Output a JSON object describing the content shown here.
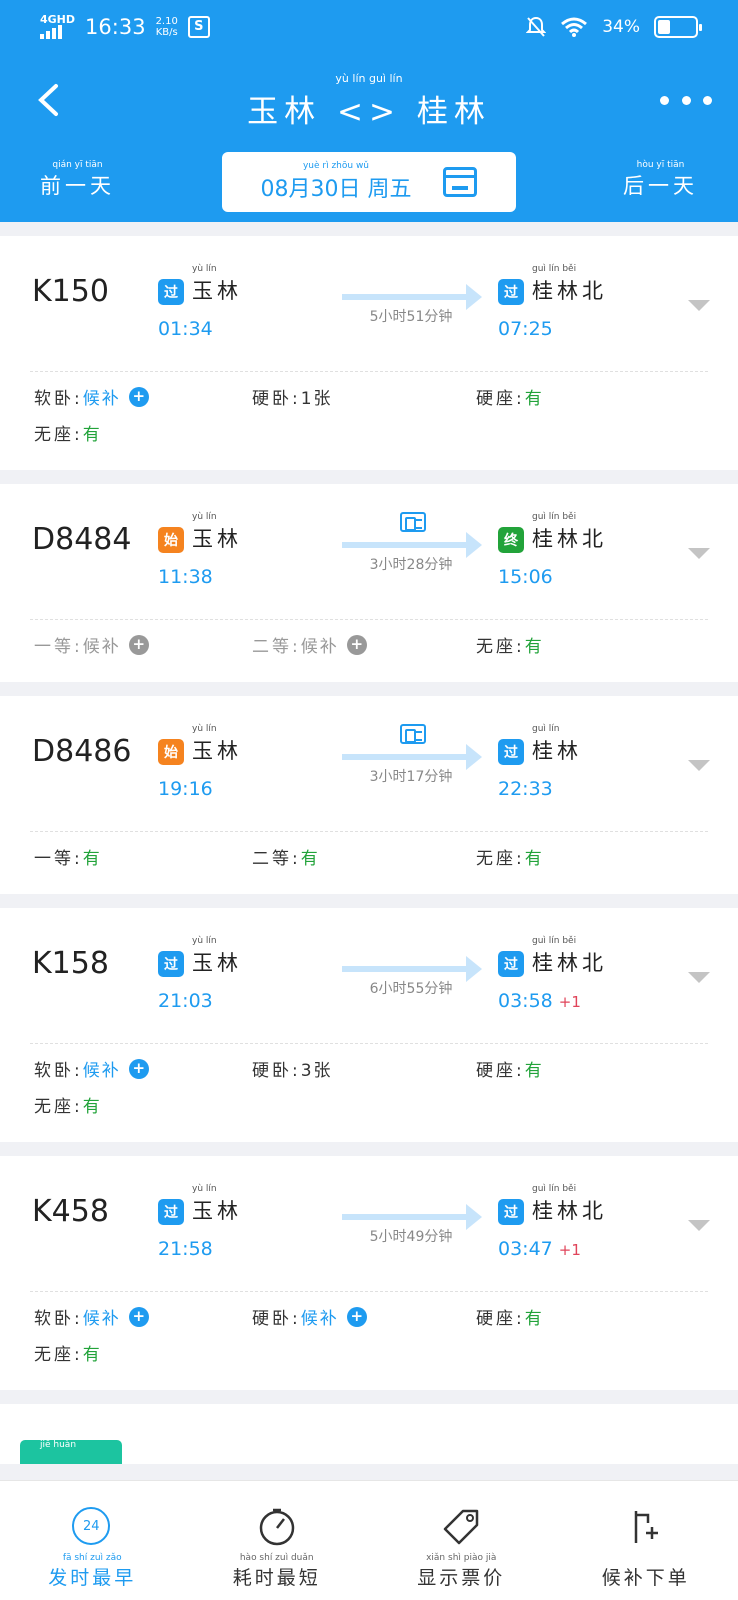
{
  "status_bar": {
    "network": "4GHD",
    "time": "16:33",
    "speed_value": "2.10",
    "speed_unit": "KB/s",
    "battery_pct": "34%",
    "battery_level": 0.34
  },
  "header": {
    "title_py": "yù   lín          guì   lín",
    "title": "玉林 <> 桂林",
    "prev_day_py": "qián yī tiān",
    "prev_day": "前一天",
    "next_day_py": "hòu yī tiān",
    "next_day": "后一天",
    "date_py": "yuè  rì  zhōu wǔ",
    "date": "08月30日 周五"
  },
  "trains": [
    {
      "number": "K150",
      "from_badge": "过",
      "from_py": "yù lín",
      "from": "玉林",
      "depart": "01:34",
      "duration": "5小时51分钟",
      "has_id_icon": false,
      "to_badge": "过",
      "to_py": "guì lín běi",
      "to": "桂林北",
      "arrive": "07:25",
      "next_day": "",
      "seats": [
        [
          {
            "name": "软卧:",
            "value": "候补",
            "plus": "+"
          },
          {
            "name": "硬卧:",
            "value": "1张"
          },
          {
            "name": "硬座:",
            "value": "有"
          }
        ],
        [
          {
            "name": "无座:",
            "value": "有"
          }
        ]
      ]
    },
    {
      "number": "D8484",
      "from_badge": "始",
      "from_py": "yù lín",
      "from": "玉林",
      "depart": "11:38",
      "duration": "3小时28分钟",
      "has_id_icon": true,
      "to_badge": "终",
      "to_py": "guì lín běi",
      "to": "桂林北",
      "arrive": "15:06",
      "next_day": "",
      "seats": [
        [
          {
            "name": "一等:",
            "value": "候补",
            "plus": "+",
            "dim": true
          },
          {
            "name": "二等:",
            "value": "候补",
            "plus": "+",
            "dim": true
          },
          {
            "name": "无座:",
            "value": "有"
          }
        ]
      ]
    },
    {
      "number": "D8486",
      "from_badge": "始",
      "from_py": "yù lín",
      "from": "玉林",
      "depart": "19:16",
      "duration": "3小时17分钟",
      "has_id_icon": true,
      "to_badge": "过",
      "to_py": "guì lín",
      "to": "桂林",
      "arrive": "22:33",
      "next_day": "",
      "seats": [
        [
          {
            "name": "一等:",
            "value": "有"
          },
          {
            "name": "二等:",
            "value": "有"
          },
          {
            "name": "无座:",
            "value": "有"
          }
        ]
      ]
    },
    {
      "number": "K158",
      "from_badge": "过",
      "from_py": "yù lín",
      "from": "玉林",
      "depart": "21:03",
      "duration": "6小时55分钟",
      "has_id_icon": false,
      "to_badge": "过",
      "to_py": "guì lín běi",
      "to": "桂林北",
      "arrive": "03:58",
      "next_day": "+1",
      "seats": [
        [
          {
            "name": "软卧:",
            "value": "候补",
            "plus": "+"
          },
          {
            "name": "硬卧:",
            "value": "3张"
          },
          {
            "name": "硬座:",
            "value": "有"
          }
        ],
        [
          {
            "name": "无座:",
            "value": "有"
          }
        ]
      ]
    },
    {
      "number": "K458",
      "from_badge": "过",
      "from_py": "yù lín",
      "from": "玉林",
      "depart": "21:58",
      "duration": "5小时49分钟",
      "has_id_icon": false,
      "to_badge": "过",
      "to_py": "guì lín běi",
      "to": "桂林北",
      "arrive": "03:47",
      "next_day": "+1",
      "seats": [
        [
          {
            "name": "软卧:",
            "value": "候补",
            "plus": "+"
          },
          {
            "name": "硬卧:",
            "value": "候补",
            "plus": "+"
          },
          {
            "name": "硬座:",
            "value": "有"
          }
        ],
        [
          {
            "name": "无座:",
            "value": "有"
          }
        ]
      ]
    }
  ],
  "transfer_tab_py": "jiē   huàn",
  "bottom_bar": {
    "tabs": [
      {
        "id": "earliest",
        "py": "fā shí zuì zǎo",
        "label": "发时最早",
        "icon": "clock-24-icon",
        "icon_text": "24",
        "active": true
      },
      {
        "id": "shortest",
        "py": "hào shí zuì duǎn",
        "label": "耗时最短",
        "icon": "timer-icon",
        "active": false
      },
      {
        "id": "price",
        "py": "xiǎn shì piào jià",
        "label": "显示票价",
        "icon": "price-tag-icon",
        "active": false
      },
      {
        "id": "waitlist",
        "py": "",
        "label": "候补下单",
        "icon": "waitlist-icon",
        "active": false
      }
    ]
  },
  "colors": {
    "primary": "#1e9bf0",
    "green": "#22a33a",
    "orange": "#f5831f",
    "red": "#e0445a",
    "teal": "#1cc4a0"
  }
}
